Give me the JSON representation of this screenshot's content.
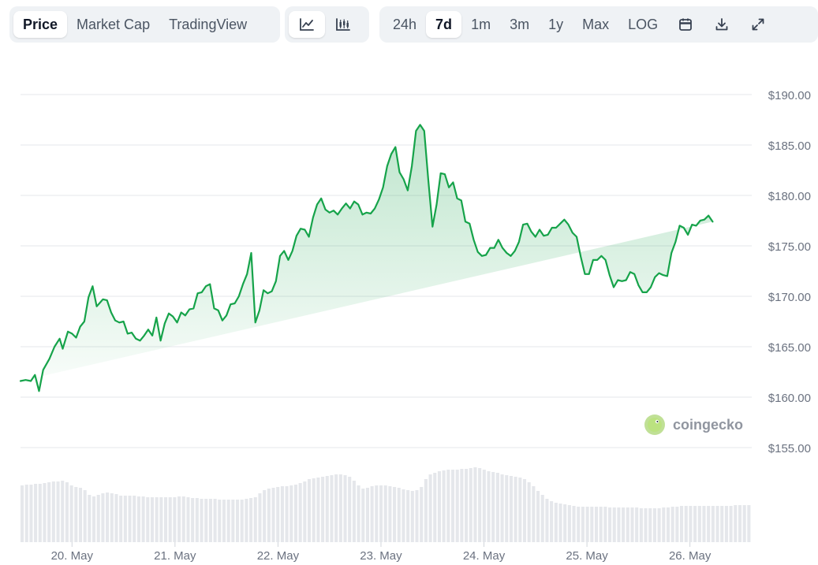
{
  "toolbar": {
    "metric_tabs": [
      {
        "label": "Price",
        "active": true
      },
      {
        "label": "Market Cap",
        "active": false
      },
      {
        "label": "TradingView",
        "active": false
      }
    ],
    "chart_type_buttons": [
      {
        "icon": "line-chart-icon",
        "active": true
      },
      {
        "icon": "candlestick-chart-icon",
        "active": false
      }
    ],
    "range_tabs": [
      {
        "label": "24h",
        "active": false
      },
      {
        "label": "7d",
        "active": true
      },
      {
        "label": "1m",
        "active": false
      },
      {
        "label": "3m",
        "active": false
      },
      {
        "label": "1y",
        "active": false
      },
      {
        "label": "Max",
        "active": false
      },
      {
        "label": "LOG",
        "active": false
      }
    ],
    "action_icons": [
      "calendar-icon",
      "download-icon",
      "expand-icon"
    ]
  },
  "watermark": {
    "text": "coingecko",
    "icon": "gecko-logo-icon"
  },
  "colors": {
    "line": "#16a34a",
    "fill": "#16a34a",
    "volume": "#e5e7eb",
    "grid": "#e5e7eb",
    "axis_text": "#6b7280"
  },
  "chart_data": {
    "type": "line",
    "title": "",
    "y_axis": {
      "min": 155,
      "max": 190,
      "ticks": [
        190,
        185,
        180,
        175,
        170,
        165,
        160,
        155
      ],
      "tick_labels": [
        "$190.00",
        "$185.00",
        "$180.00",
        "$175.00",
        "$170.00",
        "$165.00",
        "$160.00",
        "$155.00"
      ],
      "position": "right"
    },
    "x_axis": {
      "min": 0,
      "max": 7.1,
      "ticks": [
        0.5,
        1.5,
        2.5,
        3.5,
        4.5,
        5.5,
        6.5
      ],
      "tick_labels": [
        "20. May",
        "21. May",
        "22. May",
        "23. May",
        "24. May",
        "25. May",
        "26. May"
      ]
    },
    "grid": true,
    "price_series": {
      "name": "Price",
      "x": [
        0,
        0.05,
        0.1,
        0.14,
        0.18,
        0.22,
        0.28,
        0.33,
        0.38,
        0.41,
        0.46,
        0.5,
        0.54,
        0.58,
        0.62,
        0.66,
        0.7,
        0.74,
        0.8,
        0.84,
        0.88,
        0.92,
        0.96,
        1,
        1.04,
        1.08,
        1.12,
        1.16,
        1.2,
        1.24,
        1.28,
        1.32,
        1.36,
        1.4,
        1.44,
        1.48,
        1.52,
        1.56,
        1.6,
        1.64,
        1.68,
        1.72,
        1.76,
        1.8,
        1.84,
        1.88,
        1.92,
        1.96,
        2,
        2.04,
        2.08,
        2.12,
        2.16,
        2.2,
        2.24,
        2.28,
        2.32,
        2.36,
        2.4,
        2.44,
        2.48,
        2.52,
        2.56,
        2.6,
        2.64,
        2.68,
        2.72,
        2.76,
        2.8,
        2.84,
        2.88,
        2.92,
        2.96,
        3,
        3.04,
        3.08,
        3.12,
        3.16,
        3.2,
        3.24,
        3.28,
        3.32,
        3.36,
        3.4,
        3.44,
        3.48,
        3.52,
        3.56,
        3.6,
        3.64,
        3.68,
        3.72,
        3.76,
        3.8,
        3.84,
        3.88,
        3.92,
        3.96,
        4,
        4.04,
        4.08,
        4.12,
        4.16,
        4.2,
        4.24,
        4.28,
        4.32,
        4.36,
        4.4,
        4.44,
        4.48,
        4.52,
        4.56,
        4.6,
        4.64,
        4.68,
        4.72,
        4.76,
        4.8,
        4.84,
        4.88,
        4.92,
        4.96,
        5,
        5.04,
        5.08,
        5.12,
        5.16,
        5.2,
        5.24,
        5.28,
        5.32,
        5.36,
        5.4,
        5.44,
        5.48,
        5.52,
        5.56,
        5.6,
        5.64,
        5.68,
        5.72,
        5.76,
        5.8,
        5.84,
        5.88,
        5.92,
        5.96,
        6,
        6.04,
        6.08,
        6.12,
        6.16,
        6.2,
        6.24,
        6.28,
        6.32,
        6.36,
        6.4,
        6.44,
        6.48,
        6.52,
        6.56,
        6.6,
        6.64,
        6.68,
        6.72,
        6.76,
        6.8,
        6.84,
        6.88,
        6.92,
        6.96,
        7
      ],
      "y": [
        161.6,
        161.7,
        161.6,
        162.2,
        160.6,
        162.7,
        163.8,
        165,
        165.8,
        164.8,
        166.5,
        166.3,
        165.9,
        167,
        167.5,
        169.9,
        171,
        169,
        169.7,
        169.6,
        168.4,
        167.6,
        167.4,
        167.5,
        166.3,
        166.4,
        165.8,
        165.6,
        166.1,
        166.7,
        166.1,
        167.9,
        165.6,
        167.3,
        168.3,
        168,
        167.4,
        168.4,
        168.1,
        168.7,
        168.8,
        170.3,
        170.4,
        171,
        171.2,
        168.8,
        168.6,
        167.6,
        168.1,
        169.2,
        169.3,
        170,
        171.2,
        172.2,
        174.3,
        167.4,
        168.6,
        170.6,
        170.3,
        170.5,
        171.5,
        174,
        174.5,
        173.6,
        174.5,
        176,
        176.7,
        176.6,
        175.9,
        177.8,
        179.1,
        179.7,
        178.6,
        178.3,
        178.5,
        178.1,
        178.7,
        179.2,
        178.7,
        179.4,
        179.1,
        178.1,
        178.3,
        178.2,
        178.7,
        179.6,
        180.8,
        182.9,
        184.1,
        184.8,
        182.3,
        181.6,
        180.5,
        182.9,
        186.4,
        187,
        186.4,
        181.5,
        176.9,
        179.1,
        182.2,
        182.1,
        180.8,
        181.3,
        179.7,
        179.5,
        177.4,
        177.2,
        175.6,
        174.4,
        174,
        174.1,
        174.8,
        174.8,
        175.6,
        174.8,
        174.3,
        174,
        174.5,
        175.4,
        177.1,
        177.2,
        176.4,
        175.9,
        176.6,
        176,
        176.1,
        176.8,
        176.8,
        177.2,
        177.6,
        177.1,
        176.3,
        175.9,
        173.9,
        172.2,
        172.2,
        173.6,
        173.6,
        174,
        173.6,
        172.1,
        170.9,
        171.6,
        171.5,
        171.6,
        172.4,
        172.2,
        171.1,
        170.4,
        170.4,
        170.9,
        171.9,
        172.3,
        172.1,
        172,
        174.3,
        175.4,
        177,
        176.8,
        176.1,
        177.1,
        177,
        177.5,
        177.6,
        178,
        177.4
      ]
    },
    "volume_series": {
      "name": "Volume",
      "note": "relative values 0-1",
      "values": [
        0.72,
        0.73,
        0.73,
        0.74,
        0.74,
        0.75,
        0.76,
        0.77,
        0.77,
        0.78,
        0.76,
        0.72,
        0.7,
        0.69,
        0.66,
        0.6,
        0.58,
        0.6,
        0.62,
        0.63,
        0.62,
        0.61,
        0.59,
        0.59,
        0.59,
        0.59,
        0.58,
        0.58,
        0.57,
        0.57,
        0.57,
        0.57,
        0.57,
        0.57,
        0.57,
        0.58,
        0.58,
        0.57,
        0.56,
        0.56,
        0.55,
        0.55,
        0.55,
        0.55,
        0.54,
        0.54,
        0.54,
        0.54,
        0.54,
        0.54,
        0.55,
        0.56,
        0.57,
        0.62,
        0.66,
        0.68,
        0.69,
        0.7,
        0.71,
        0.71,
        0.72,
        0.73,
        0.75,
        0.77,
        0.8,
        0.81,
        0.82,
        0.83,
        0.84,
        0.85,
        0.86,
        0.86,
        0.85,
        0.83,
        0.78,
        0.72,
        0.68,
        0.69,
        0.71,
        0.72,
        0.72,
        0.72,
        0.71,
        0.7,
        0.69,
        0.67,
        0.66,
        0.65,
        0.66,
        0.7,
        0.8,
        0.86,
        0.88,
        0.9,
        0.91,
        0.92,
        0.92,
        0.92,
        0.93,
        0.93,
        0.94,
        0.95,
        0.94,
        0.92,
        0.9,
        0.89,
        0.88,
        0.86,
        0.85,
        0.84,
        0.83,
        0.82,
        0.8,
        0.76,
        0.71,
        0.65,
        0.6,
        0.55,
        0.52,
        0.5,
        0.49,
        0.48,
        0.47,
        0.46,
        0.45,
        0.45,
        0.45,
        0.45,
        0.45,
        0.45,
        0.45,
        0.44,
        0.44,
        0.44,
        0.44,
        0.44,
        0.44,
        0.44,
        0.43,
        0.43,
        0.43,
        0.43,
        0.43,
        0.44,
        0.44,
        0.45,
        0.45,
        0.46,
        0.46,
        0.46,
        0.46,
        0.46,
        0.46,
        0.46,
        0.46,
        0.46,
        0.46,
        0.46,
        0.46,
        0.47,
        0.47,
        0.47,
        0.47
      ]
    }
  }
}
